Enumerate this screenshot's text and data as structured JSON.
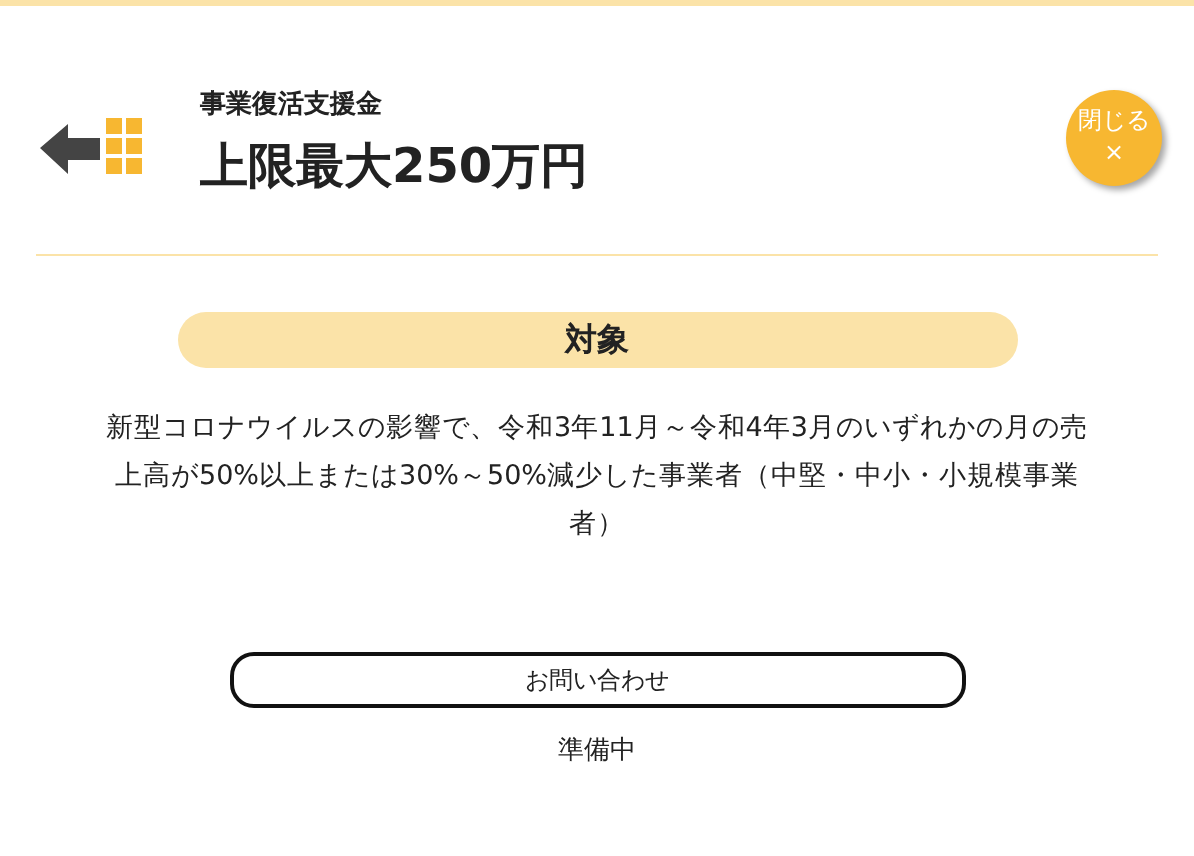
{
  "header": {
    "subtitle": "事業復活支援金",
    "title": "上限最大250万円",
    "close_button": {
      "label": "閉じる",
      "symbol": "×"
    }
  },
  "section": {
    "heading": "対象",
    "body": "新型コロナウイルスの影響で、令和3年11月～令和4年3月のいずれかの月の売上高が50%以上または30%～50%減少した事業者（中堅・中小・小規模事業者）"
  },
  "contact_button": {
    "label": "お問い合わせ"
  },
  "status": "準備中"
}
